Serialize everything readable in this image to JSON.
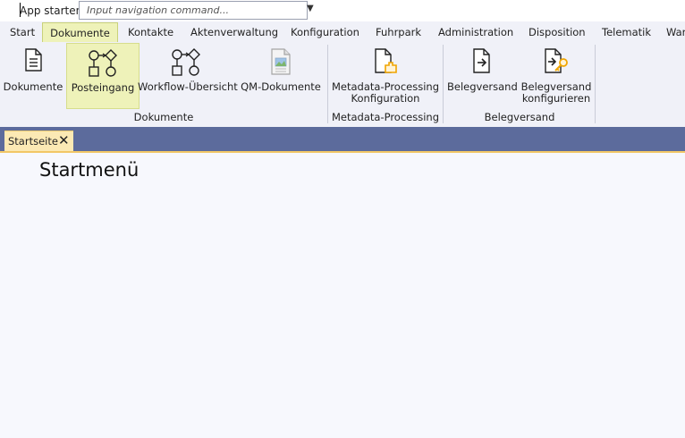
{
  "command_bar": {
    "label": "App starten",
    "input_placeholder": "Input navigation command...",
    "dropdown_glyph": "▼"
  },
  "menu_tabs": [
    {
      "label": "Start"
    },
    {
      "label": "Dokumente",
      "active": true
    },
    {
      "label": "Kontakte"
    },
    {
      "label": "Aktenverwaltung"
    },
    {
      "label": "Konfiguration"
    },
    {
      "label": "Fuhrpark"
    },
    {
      "label": "Administration"
    },
    {
      "label": "Disposition"
    },
    {
      "label": "Telematik"
    },
    {
      "label": "War"
    }
  ],
  "ribbon": {
    "buttons": {
      "dokumente": "Dokumente",
      "posteingang": "Posteingang",
      "workflow": "Workflow-Übersicht",
      "qm": "QM-Dokumente",
      "metadata_line1": "Metadata-Processing",
      "metadata_line2": "Konfiguration",
      "belegversand": "Belegversand",
      "beleg_konf_line1": "Belegversand",
      "beleg_konf_line2": "konfigurieren"
    },
    "groups": {
      "dokumente": "Dokumente",
      "metadata": "Metadata-Processing",
      "belegversand": "Belegversand"
    },
    "highlight_color": "#eef2b9",
    "icon_accent": "#f0a500"
  },
  "doc_tabs": [
    {
      "label": "Startseite",
      "close_glyph": "✕"
    }
  ],
  "content": {
    "title": "Startmenü"
  },
  "colors": {
    "doc_strip": "#5c6b9c",
    "doc_tab": "#fbe9b4",
    "ribbon_bg": "#f0f1f8"
  }
}
